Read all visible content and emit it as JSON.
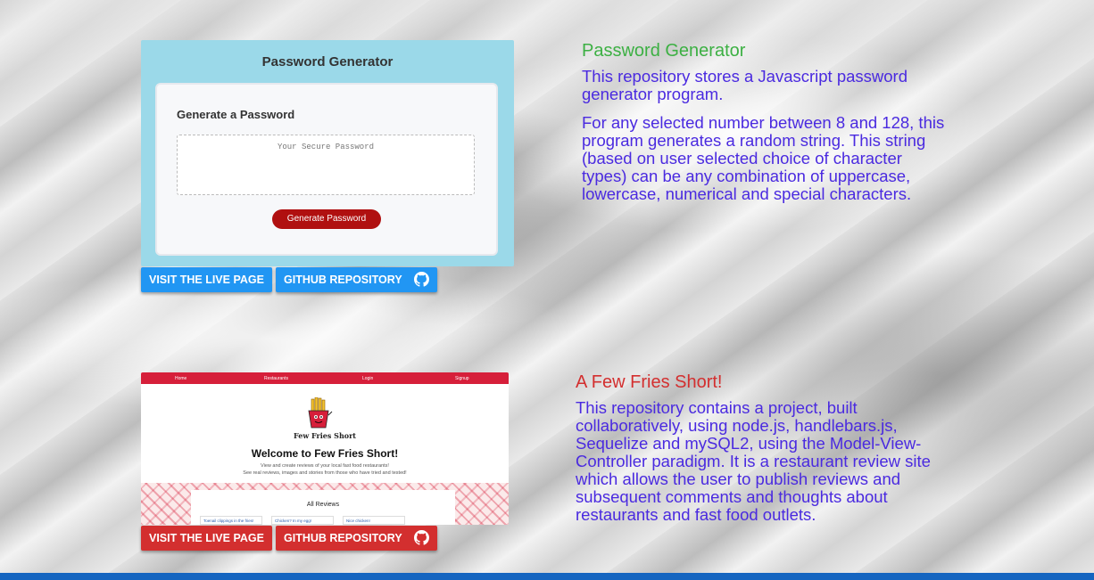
{
  "colors": {
    "project1_title": "#3cb043",
    "project2_title": "#d32f2f",
    "body_text": "#4a2ae0",
    "button_blue": "#2196f3",
    "button_red": "#d32f2f",
    "footer": "#1565c0"
  },
  "projects": [
    {
      "title": "Password Generator",
      "paragraphs": [
        "This repository stores a Javascript password generator program.",
        "For any selected number between 8 and 128, this program generates a random string. This string (based on user selected choice of character types) can be any combination of uppercase, lowercase, numerical and special characters."
      ],
      "screenshot": {
        "header": "Password Generator",
        "card_title": "Generate a Password",
        "placeholder": "Your Secure Password",
        "button": "Generate Password"
      },
      "live_button": "VISIT THE LIVE PAGE",
      "repo_button": "GITHUB REPOSITORY",
      "repo_icon": "github-icon"
    },
    {
      "title": "A Few Fries Short!",
      "paragraphs": [
        "This repository contains a project, built collaboratively, using node.js, handlebars.js, Sequelize and mySQL2, using the Model-View-Controller paradigm. It is a restaurant review site which allows the user to publish reviews and subsequent comments and thoughts about restaurants and fast food outlets."
      ],
      "screenshot": {
        "nav": [
          "Home",
          "Restaurants",
          "Login",
          "Signup"
        ],
        "brand": "Few Fries Short",
        "welcome": "Welcome to Few Fries Short!",
        "sub1": "View and create reviews of your local fast food restaurants!",
        "sub2": "See real reviews, images and stories from those who have tried and tested!",
        "reviews_title": "All Reviews",
        "cards": [
          "Toenail clippings in the fries!",
          "Chicken? In my egg!",
          "Nice chicken!"
        ]
      },
      "live_button": "VISIT THE LIVE PAGE",
      "repo_button": "GITHUB REPOSITORY",
      "repo_icon": "github-icon"
    }
  ]
}
